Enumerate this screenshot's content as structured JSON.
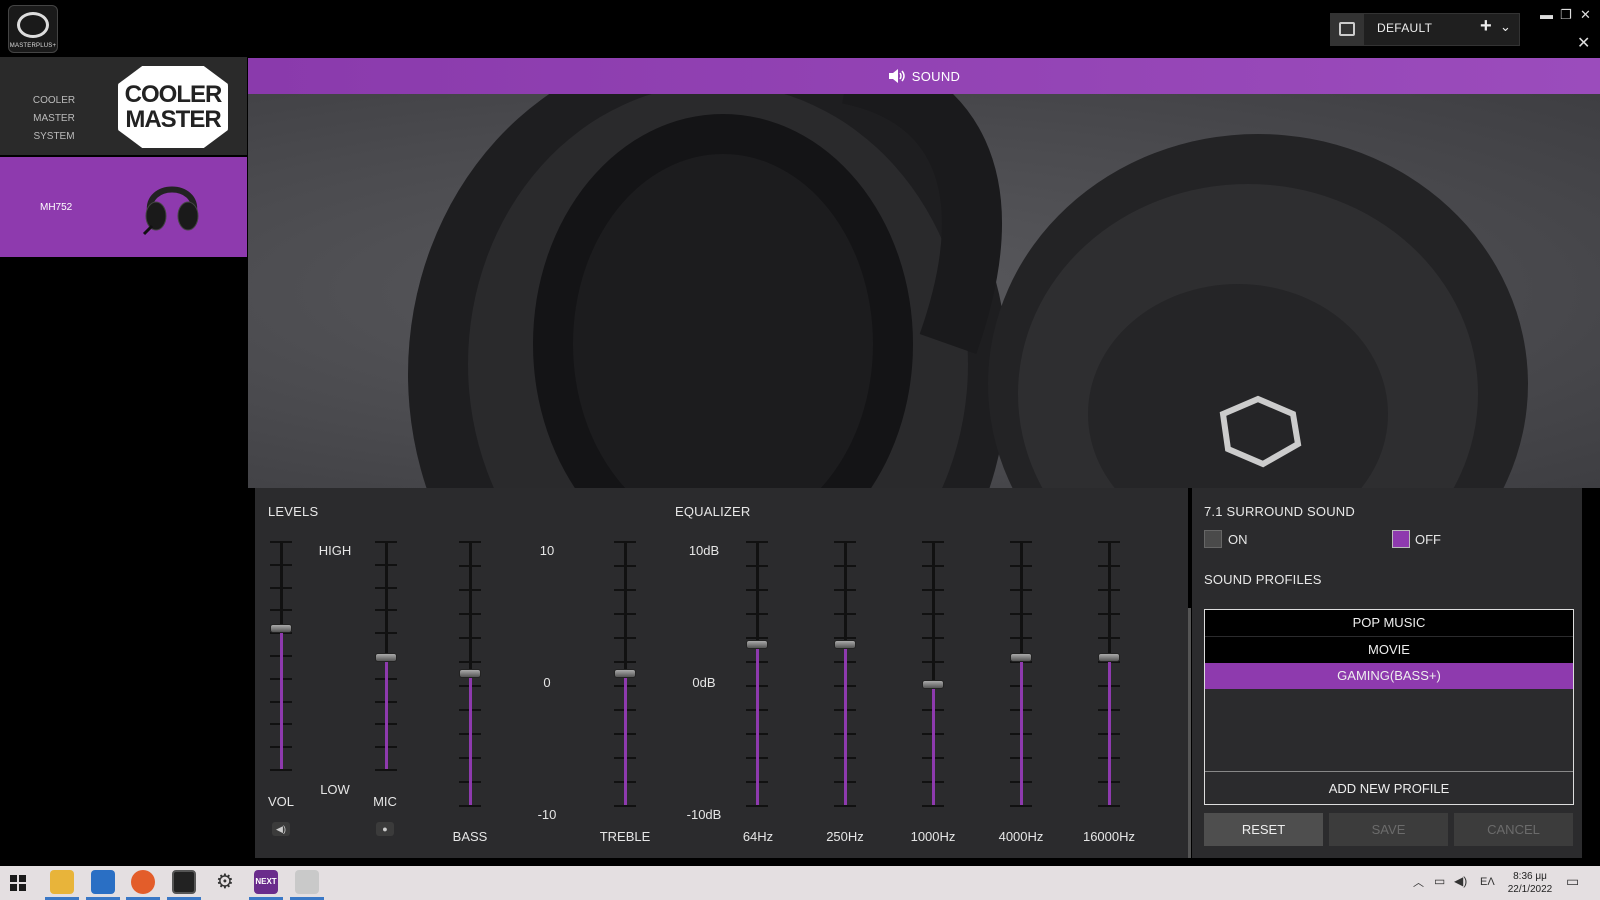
{
  "app": {
    "logo_text": "MASTERPLUS+",
    "icons": {
      "minimize": "minimize-icon",
      "restore": "restore-icon",
      "close": "close-icon",
      "pin": "pin-icon"
    }
  },
  "profile_selector": {
    "name": "DEFAULT",
    "add_symbol": "+",
    "dropdown_symbol": "⌄"
  },
  "sidebar": {
    "brand_label_line1": "COOLER MASTER",
    "brand_label_line2": "SYSTEM",
    "brand_logo_line1": "COOLER",
    "brand_logo_line2": "MASTER",
    "device_label": "MH752"
  },
  "header": {
    "title": "SOUND"
  },
  "levels": {
    "title": "LEVELS",
    "vol_label": "VOL",
    "mic_label": "MIC",
    "high_label": "HIGH",
    "low_label": "LOW",
    "bass_label": "BASS",
    "treble_label": "TREBLE",
    "scale_top": "10",
    "scale_mid": "0",
    "scale_bottom": "-10",
    "vol_level": 0.62,
    "mic_level": 0.49,
    "bass_level": 0.5,
    "treble_level": 0.5
  },
  "equalizer": {
    "title": "EQUALIZER",
    "scale_top": "10dB",
    "scale_mid": "0dB",
    "scale_bottom": "-10dB",
    "bands": [
      {
        "label": "64Hz",
        "level": 0.61
      },
      {
        "label": "250Hz",
        "level": 0.61
      },
      {
        "label": "1000Hz",
        "level": 0.46
      },
      {
        "label": "4000Hz",
        "level": 0.56
      },
      {
        "label": "16000Hz",
        "level": 0.56
      }
    ]
  },
  "surround": {
    "title": "7.1 SURROUND SOUND",
    "on_label": "ON",
    "off_label": "OFF",
    "selected": "OFF",
    "accent_color": "#8e3aae"
  },
  "sound_profiles": {
    "title": "SOUND PROFILES",
    "items": [
      "POP MUSIC",
      "MOVIE",
      "GAMING(BASS+)"
    ],
    "selected": "GAMING(BASS+)",
    "add_label": "ADD NEW PROFILE"
  },
  "buttons": {
    "reset": "RESET",
    "save": "SAVE",
    "cancel": "CANCEL"
  },
  "taskbar": {
    "lang": "ΕΛ",
    "time": "8:36 μμ",
    "date": "22/1/2022",
    "next_label": "NEXT"
  }
}
